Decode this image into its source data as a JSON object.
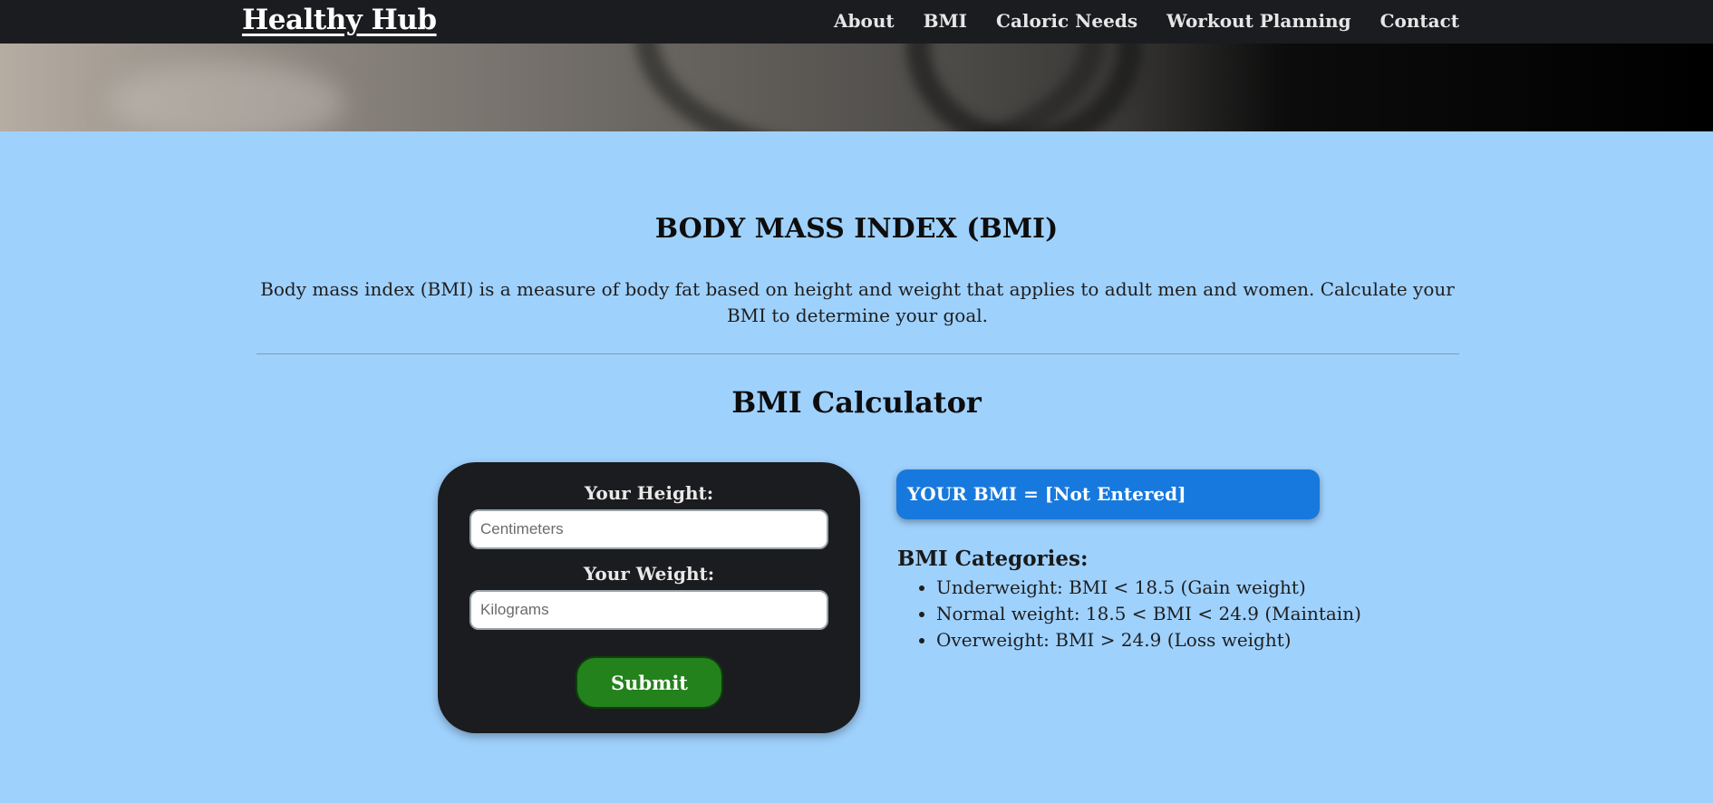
{
  "nav": {
    "brand": "Healthy Hub",
    "links": [
      "About",
      "BMI",
      "Caloric Needs",
      "Workout Planning",
      "Contact"
    ]
  },
  "intro": {
    "title": "BODY MASS INDEX (BMI)",
    "text": "Body mass index (BMI) is a measure of body fat based on height and weight that applies to adult men and women. Calculate your BMI to determine your goal."
  },
  "calculator": {
    "title": "BMI Calculator",
    "height_label": "Your Height:",
    "height_placeholder": "Centimeters",
    "height_value": "",
    "weight_label": "Your Weight:",
    "weight_placeholder": "Kilograms",
    "weight_value": "",
    "submit_label": "Submit"
  },
  "result": {
    "text": "YOUR BMI = [Not Entered]"
  },
  "categories": {
    "title": "BMI Categories:",
    "items": [
      "Underweight: BMI < 18.5 (Gain weight)",
      "Normal weight: 18.5 < BMI < 24.9 (Maintain)",
      "Overweight: BMI > 24.9 (Loss weight)"
    ]
  },
  "colors": {
    "page_bg": "#9fd1fd",
    "navbar_bg": "#1b1c20",
    "card_bg": "#1b1c1f",
    "result_bg": "#1779dd",
    "submit_bg": "#23821c"
  }
}
